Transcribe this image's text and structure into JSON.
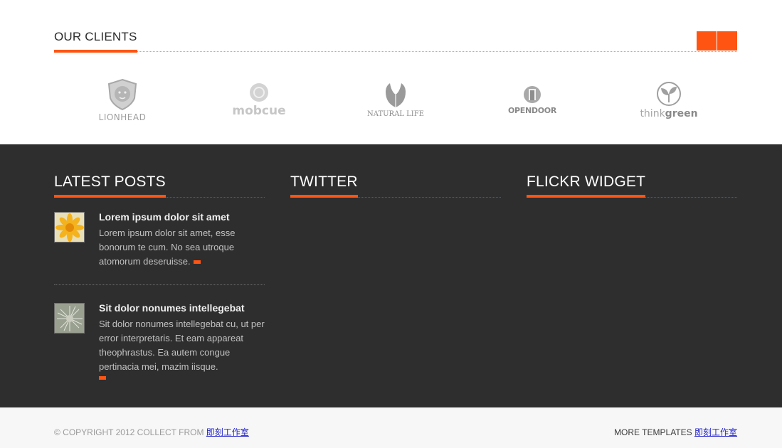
{
  "clients": {
    "title": "OUR CLIENTS",
    "logos": [
      {
        "name": "LIONHEAD",
        "icon": "lion-shield-icon"
      },
      {
        "name": "mobcue",
        "icon": "mobcue-circle-icon"
      },
      {
        "name": "NATURAL LIFE",
        "icon": "leaf-icon"
      },
      {
        "name": "OPENDOOR",
        "icon": "door-icon"
      },
      {
        "name": "think",
        "name_bold": "green",
        "icon": "sprout-icon"
      }
    ]
  },
  "widgets": {
    "latest_posts": {
      "title": "LATEST POSTS",
      "posts": [
        {
          "title": "Lorem ipsum dolor sit amet",
          "text": "Lorem ipsum dolor sit amet, esse bonorum te cum. No sea utroque atomorum deseruisse."
        },
        {
          "title": "Sit dolor nonumes intellegebat",
          "text": "Sit dolor nonumes intellegebat cu, ut per error interpretaris. Et eam appareat theophrastus. Ea autem congue pertinacia mei, mazim iisque."
        }
      ]
    },
    "twitter": {
      "title": "TWITTER"
    },
    "flickr": {
      "title": "FLICKR WIDGET"
    }
  },
  "footer": {
    "copyright": "© COPYRIGHT 2012 COLLECT FROM",
    "copyright_link": "即刻工作室",
    "more_label": "MORE TEMPLATES",
    "more_link": "即刻工作室"
  },
  "colors": {
    "accent": "#ff5412",
    "dark_bg": "#2f2e2e",
    "footer_bg": "#f7f7f7"
  }
}
